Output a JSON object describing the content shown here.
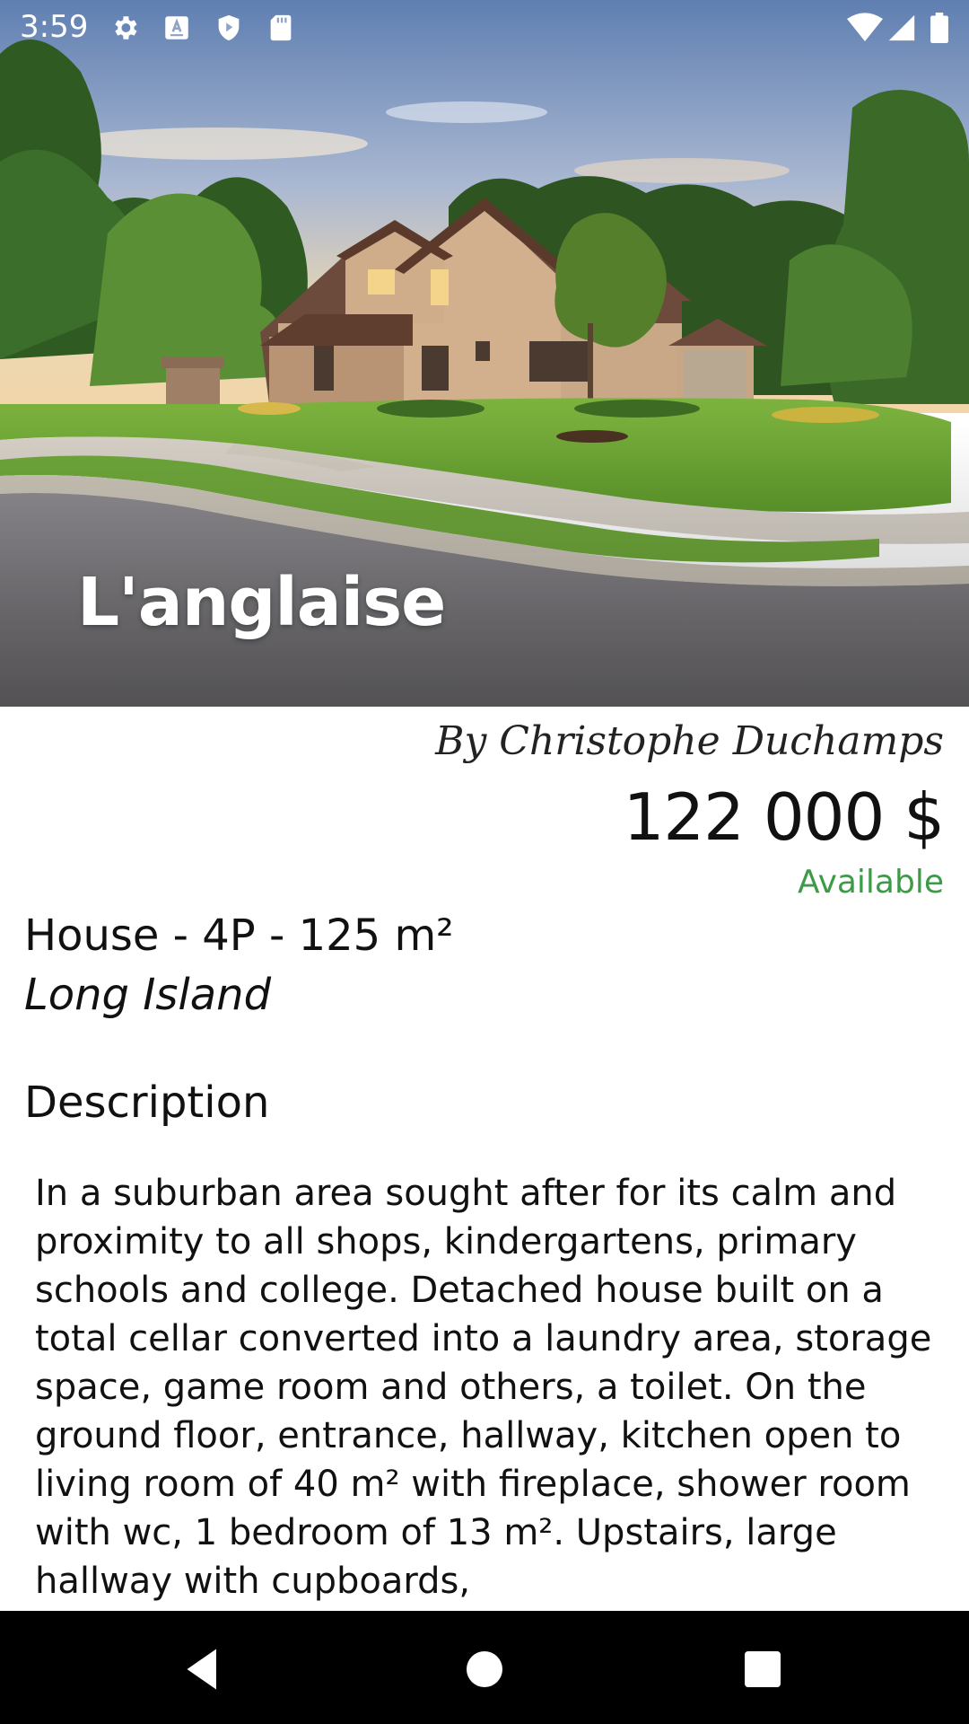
{
  "status_bar": {
    "time": "3:59",
    "icons": [
      "gear-icon",
      "keyboard-icon",
      "play-protect-icon",
      "sd-card-icon",
      "wifi-icon",
      "cell-signal-icon",
      "battery-icon"
    ]
  },
  "hero": {
    "title": "L'anglaise"
  },
  "listing": {
    "author": "By Christophe Duchamps",
    "price": "122 000 $",
    "availability": "Available",
    "availability_color": "#3d9a47",
    "summary": "House - 4P - 125 m²",
    "location": "Long Island"
  },
  "description": {
    "heading": "Description",
    "text": "In a suburban area sought after for its calm and proximity to all shops, kindergartens, primary schools and college. Detached house built on a total cellar converted into a laundry area, storage space, game room and others, a toilet. On the ground floor, entrance, hallway, kitchen open to living room of 40 m² with fireplace, shower room with wc, 1 bedroom of 13 m². Upstairs, large hallway with cupboards,"
  },
  "nav_bar": {
    "buttons": [
      "back-icon",
      "home-icon",
      "recents-icon"
    ]
  }
}
